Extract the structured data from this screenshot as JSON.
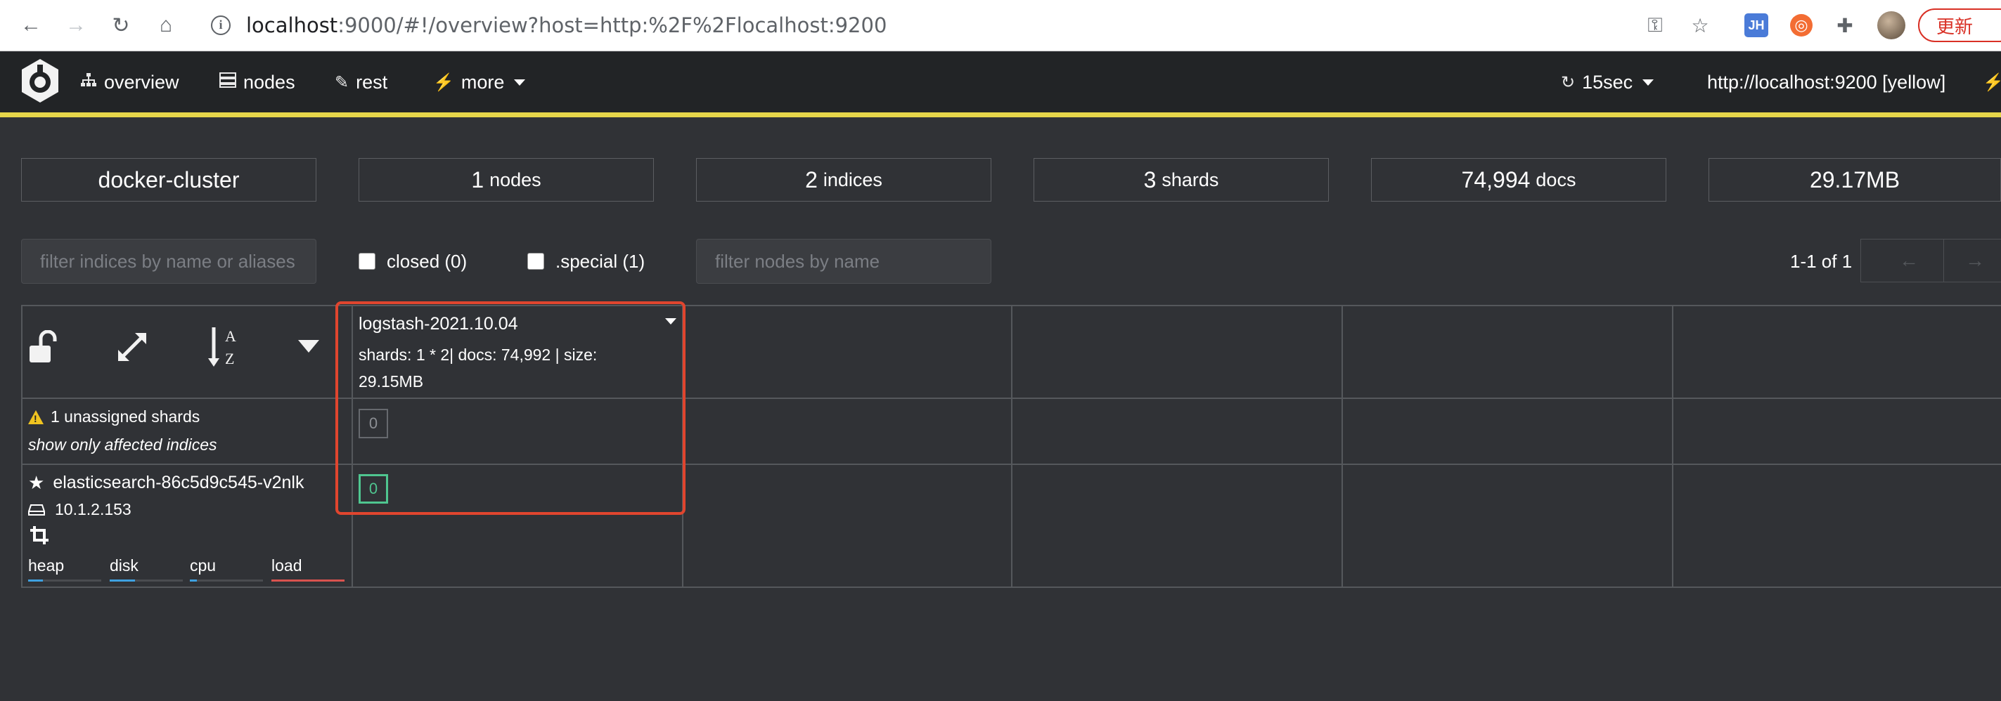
{
  "browser": {
    "url_host": "localhost",
    "url_rest": ":9000/#!/overview?host=http:%2F%2Flocalhost:9200",
    "update_label": "更新",
    "ext_jh": "JH"
  },
  "navbar": {
    "items": [
      {
        "label": "overview",
        "icon": "sitemap-icon"
      },
      {
        "label": "nodes",
        "icon": "server-icon"
      },
      {
        "label": "rest",
        "icon": "edit-icon"
      },
      {
        "label": "more",
        "icon": "magic-wand-icon"
      }
    ],
    "refresh": "15sec",
    "cluster_url": "http://localhost:9200 [yellow]",
    "status_color": "#e6d64a"
  },
  "summary": {
    "cluster_name": "docker-cluster",
    "nodes_count": "1",
    "nodes_unit": "nodes",
    "indices_count": "2",
    "indices_unit": "indices",
    "shards_count": "3",
    "shards_unit": "shards",
    "docs_count": "74,994",
    "docs_unit": "docs",
    "size": "29.17MB"
  },
  "filters": {
    "indices_placeholder": "filter indices by name or aliases",
    "closed_label": "closed (0)",
    "special_label": ".special (1)",
    "nodes_placeholder": "filter nodes by name",
    "pagination": "1-1 of 1",
    "prev": "←",
    "next": "→"
  },
  "index": {
    "name": "logstash-2021.10.04",
    "info_line1": "shards: 1 * 2| docs: 74,992 | size:",
    "info_line2": "29.15MB"
  },
  "unassigned": {
    "label": "1 unassigned shards",
    "link": "show only affected indices",
    "shard": "0"
  },
  "node": {
    "name": "elasticsearch-86c5d9c545-v2nlk",
    "ip": "10.1.2.153",
    "shard": "0",
    "metrics": [
      {
        "label": "heap",
        "value": 0.2
      },
      {
        "label": "disk",
        "value": 0.35
      },
      {
        "label": "cpu",
        "value": 0.1
      },
      {
        "label": "load",
        "value": 1.0
      }
    ]
  },
  "colors": {
    "started_shard": "#4fc690",
    "highlight": "#e0452e"
  }
}
